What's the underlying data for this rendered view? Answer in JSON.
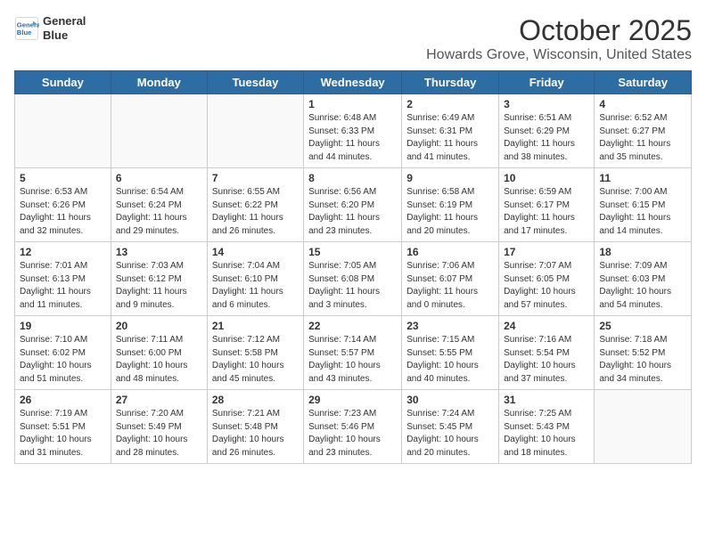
{
  "header": {
    "logo_line1": "General",
    "logo_line2": "Blue",
    "month": "October 2025",
    "location": "Howards Grove, Wisconsin, United States"
  },
  "weekdays": [
    "Sunday",
    "Monday",
    "Tuesday",
    "Wednesday",
    "Thursday",
    "Friday",
    "Saturday"
  ],
  "weeks": [
    [
      {
        "day": "",
        "info": ""
      },
      {
        "day": "",
        "info": ""
      },
      {
        "day": "",
        "info": ""
      },
      {
        "day": "1",
        "info": "Sunrise: 6:48 AM\nSunset: 6:33 PM\nDaylight: 11 hours\nand 44 minutes."
      },
      {
        "day": "2",
        "info": "Sunrise: 6:49 AM\nSunset: 6:31 PM\nDaylight: 11 hours\nand 41 minutes."
      },
      {
        "day": "3",
        "info": "Sunrise: 6:51 AM\nSunset: 6:29 PM\nDaylight: 11 hours\nand 38 minutes."
      },
      {
        "day": "4",
        "info": "Sunrise: 6:52 AM\nSunset: 6:27 PM\nDaylight: 11 hours\nand 35 minutes."
      }
    ],
    [
      {
        "day": "5",
        "info": "Sunrise: 6:53 AM\nSunset: 6:26 PM\nDaylight: 11 hours\nand 32 minutes."
      },
      {
        "day": "6",
        "info": "Sunrise: 6:54 AM\nSunset: 6:24 PM\nDaylight: 11 hours\nand 29 minutes."
      },
      {
        "day": "7",
        "info": "Sunrise: 6:55 AM\nSunset: 6:22 PM\nDaylight: 11 hours\nand 26 minutes."
      },
      {
        "day": "8",
        "info": "Sunrise: 6:56 AM\nSunset: 6:20 PM\nDaylight: 11 hours\nand 23 minutes."
      },
      {
        "day": "9",
        "info": "Sunrise: 6:58 AM\nSunset: 6:19 PM\nDaylight: 11 hours\nand 20 minutes."
      },
      {
        "day": "10",
        "info": "Sunrise: 6:59 AM\nSunset: 6:17 PM\nDaylight: 11 hours\nand 17 minutes."
      },
      {
        "day": "11",
        "info": "Sunrise: 7:00 AM\nSunset: 6:15 PM\nDaylight: 11 hours\nand 14 minutes."
      }
    ],
    [
      {
        "day": "12",
        "info": "Sunrise: 7:01 AM\nSunset: 6:13 PM\nDaylight: 11 hours\nand 11 minutes."
      },
      {
        "day": "13",
        "info": "Sunrise: 7:03 AM\nSunset: 6:12 PM\nDaylight: 11 hours\nand 9 minutes."
      },
      {
        "day": "14",
        "info": "Sunrise: 7:04 AM\nSunset: 6:10 PM\nDaylight: 11 hours\nand 6 minutes."
      },
      {
        "day": "15",
        "info": "Sunrise: 7:05 AM\nSunset: 6:08 PM\nDaylight: 11 hours\nand 3 minutes."
      },
      {
        "day": "16",
        "info": "Sunrise: 7:06 AM\nSunset: 6:07 PM\nDaylight: 11 hours\nand 0 minutes."
      },
      {
        "day": "17",
        "info": "Sunrise: 7:07 AM\nSunset: 6:05 PM\nDaylight: 10 hours\nand 57 minutes."
      },
      {
        "day": "18",
        "info": "Sunrise: 7:09 AM\nSunset: 6:03 PM\nDaylight: 10 hours\nand 54 minutes."
      }
    ],
    [
      {
        "day": "19",
        "info": "Sunrise: 7:10 AM\nSunset: 6:02 PM\nDaylight: 10 hours\nand 51 minutes."
      },
      {
        "day": "20",
        "info": "Sunrise: 7:11 AM\nSunset: 6:00 PM\nDaylight: 10 hours\nand 48 minutes."
      },
      {
        "day": "21",
        "info": "Sunrise: 7:12 AM\nSunset: 5:58 PM\nDaylight: 10 hours\nand 45 minutes."
      },
      {
        "day": "22",
        "info": "Sunrise: 7:14 AM\nSunset: 5:57 PM\nDaylight: 10 hours\nand 43 minutes."
      },
      {
        "day": "23",
        "info": "Sunrise: 7:15 AM\nSunset: 5:55 PM\nDaylight: 10 hours\nand 40 minutes."
      },
      {
        "day": "24",
        "info": "Sunrise: 7:16 AM\nSunset: 5:54 PM\nDaylight: 10 hours\nand 37 minutes."
      },
      {
        "day": "25",
        "info": "Sunrise: 7:18 AM\nSunset: 5:52 PM\nDaylight: 10 hours\nand 34 minutes."
      }
    ],
    [
      {
        "day": "26",
        "info": "Sunrise: 7:19 AM\nSunset: 5:51 PM\nDaylight: 10 hours\nand 31 minutes."
      },
      {
        "day": "27",
        "info": "Sunrise: 7:20 AM\nSunset: 5:49 PM\nDaylight: 10 hours\nand 28 minutes."
      },
      {
        "day": "28",
        "info": "Sunrise: 7:21 AM\nSunset: 5:48 PM\nDaylight: 10 hours\nand 26 minutes."
      },
      {
        "day": "29",
        "info": "Sunrise: 7:23 AM\nSunset: 5:46 PM\nDaylight: 10 hours\nand 23 minutes."
      },
      {
        "day": "30",
        "info": "Sunrise: 7:24 AM\nSunset: 5:45 PM\nDaylight: 10 hours\nand 20 minutes."
      },
      {
        "day": "31",
        "info": "Sunrise: 7:25 AM\nSunset: 5:43 PM\nDaylight: 10 hours\nand 18 minutes."
      },
      {
        "day": "",
        "info": ""
      }
    ]
  ]
}
